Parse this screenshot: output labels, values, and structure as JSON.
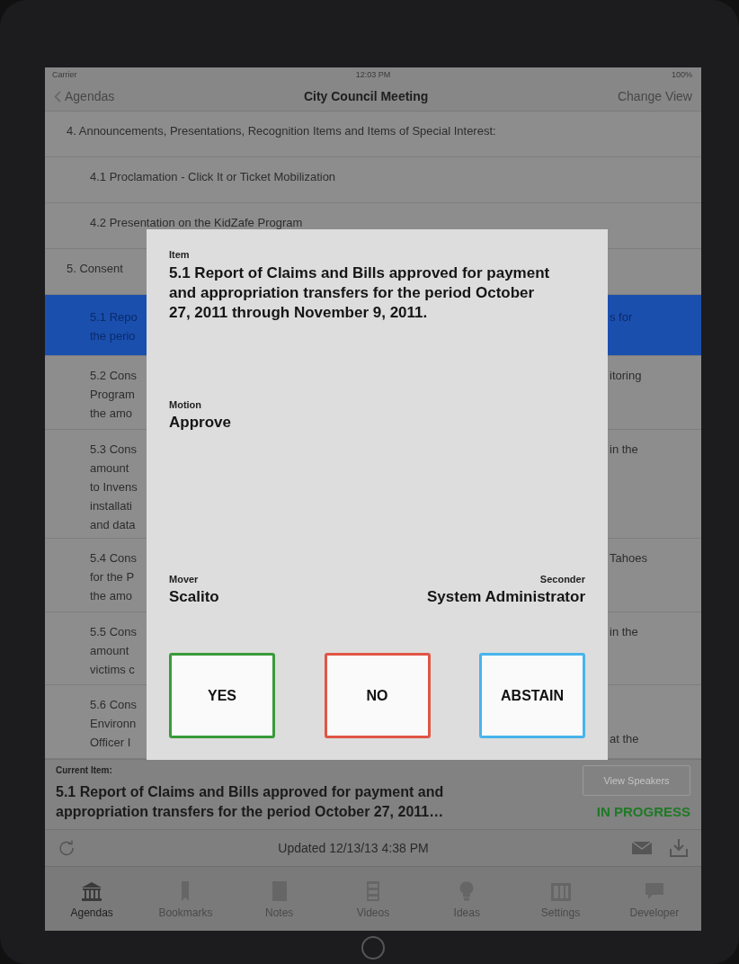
{
  "status_bar": {
    "carrier": "Carrier",
    "time": "12:03 PM",
    "battery": "100%"
  },
  "nav_bar": {
    "back": "Agendas",
    "title": "City Council Meeting",
    "action": "Change View"
  },
  "agenda_rows": [
    {
      "indented": false,
      "selected": false,
      "left_lines": [
        "4. Announcements, Presentations, Recognition Items and Items of Special Interest:"
      ],
      "right_lines": []
    },
    {
      "indented": true,
      "selected": false,
      "left_lines": [
        "4.1 Proclamation - Click It or Ticket Mobilization"
      ],
      "right_lines": []
    },
    {
      "indented": true,
      "selected": false,
      "left_lines": [
        "4.2 Presentation on the KidZafe Program"
      ],
      "right_lines": []
    },
    {
      "indented": false,
      "selected": false,
      "left_lines": [
        "5. Consent"
      ],
      "right_lines": []
    },
    {
      "indented": true,
      "selected": true,
      "left_lines": [
        "5.1 Repo",
        "the perio"
      ],
      "right_lines": [
        "s for"
      ]
    },
    {
      "indented": true,
      "selected": false,
      "left_lines": [
        "5.2 Cons",
        "Program",
        "the amo"
      ],
      "right_lines": [
        "itoring"
      ]
    },
    {
      "indented": true,
      "selected": false,
      "left_lines": [
        "5.3 Cons",
        "amount",
        "to Invens",
        "installati",
        "and data"
      ],
      "right_lines": [
        "in the"
      ]
    },
    {
      "indented": true,
      "selected": false,
      "left_lines": [
        "5.4 Cons",
        "for the P",
        "the amo"
      ],
      "right_lines": [
        "Tahoes"
      ]
    },
    {
      "indented": true,
      "selected": false,
      "left_lines": [
        "5.5 Cons",
        "amount",
        "victims c"
      ],
      "right_lines": [
        "in the"
      ]
    },
    {
      "indented": true,
      "selected": false,
      "left_lines": [
        "5.6 Cons",
        "Environn",
        "Officer I"
      ],
      "right_lines": [
        "at the"
      ],
      "right_at_bottom": true
    }
  ],
  "dialog": {
    "item_label": "Item",
    "item": "5.1 Report of Claims and Bills approved for payment and appropriation transfers for the period October 27, 2011 through November 9, 2011.",
    "motion_label": "Motion",
    "motion": "Approve",
    "mover_label": "Mover",
    "mover": "Scalito",
    "seconder_label": "Seconder",
    "seconder": "System Administrator",
    "vote_buttons": [
      {
        "label": "YES",
        "color": "#3a9a3a"
      },
      {
        "label": "NO",
        "color": "#e05545"
      },
      {
        "label": "ABSTAIN",
        "color": "#48b4ec"
      }
    ]
  },
  "current_item": {
    "label": "Current Item:",
    "text": "5.1 Report of Claims and Bills approved for payment and appropriation transfers for the period October 27, 2011…",
    "view_speakers": "View Speakers",
    "status": "IN PROGRESS"
  },
  "toolbar": {
    "updated": "Updated 12/13/13 4:38 PM"
  },
  "tabs": [
    {
      "label": "Agendas",
      "kind": "building",
      "selected": true
    },
    {
      "label": "Bookmarks",
      "kind": "bookmark",
      "selected": false
    },
    {
      "label": "Notes",
      "kind": "notes",
      "selected": false
    },
    {
      "label": "Videos",
      "kind": "film",
      "selected": false
    },
    {
      "label": "Ideas",
      "kind": "bulb",
      "selected": false
    },
    {
      "label": "Settings",
      "kind": "columns",
      "selected": false
    },
    {
      "label": "Developer",
      "kind": "chat",
      "selected": false
    }
  ]
}
